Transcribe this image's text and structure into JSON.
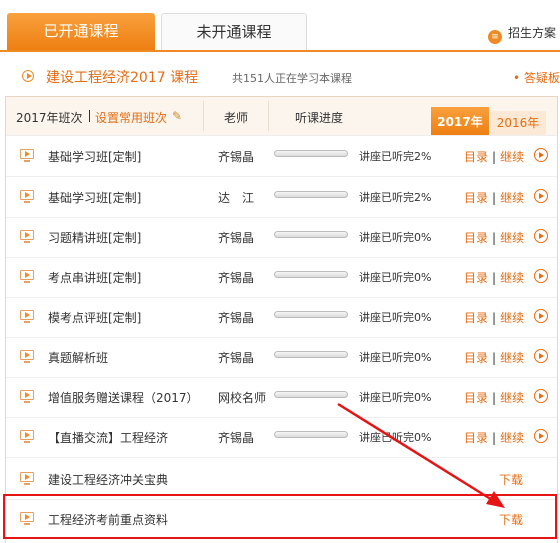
{
  "tabs": {
    "active": "已开通课程",
    "inactive": "未开通课程"
  },
  "admission": {
    "icon": "list-icon",
    "label": "招生方案"
  },
  "course": {
    "title": "建设工程经济2017 课程",
    "count_text": "共151人正在学习本课程",
    "qa_link": "• 答疑板"
  },
  "table_header": {
    "class_label": "2017年班次",
    "setting_label": "设置常用班次",
    "teacher_label": "老师",
    "progress_label": "听课进度",
    "year_active": "2017年",
    "year_inactive": "2016年"
  },
  "rows": [
    {
      "name": "基础学习班[定制]",
      "teacher": "齐锡晶",
      "progress": "讲座已听完2%",
      "catalog": "目录",
      "sep": "|",
      "continue": "继续"
    },
    {
      "name": "基础学习班[定制]",
      "teacher": "达　江",
      "progress": "讲座已听完2%",
      "catalog": "目录",
      "sep": "|",
      "continue": "继续"
    },
    {
      "name": "习题精讲班[定制]",
      "teacher": "齐锡晶",
      "progress": "讲座已听完0%",
      "catalog": "目录",
      "sep": "|",
      "continue": "继续"
    },
    {
      "name": "考点串讲班[定制]",
      "teacher": "齐锡晶",
      "progress": "讲座已听完0%",
      "catalog": "目录",
      "sep": "|",
      "continue": "继续"
    },
    {
      "name": "模考点评班[定制]",
      "teacher": "齐锡晶",
      "progress": "讲座已听完0%",
      "catalog": "目录",
      "sep": "|",
      "continue": "继续"
    },
    {
      "name": "真题解析班",
      "teacher": "齐锡晶",
      "progress": "讲座已听完0%",
      "catalog": "目录",
      "sep": "|",
      "continue": "继续"
    },
    {
      "name": "增值服务赠送课程（2017）",
      "teacher": "网校名师",
      "progress": "讲座已听完0%",
      "catalog": "目录",
      "sep": "|",
      "continue": "继续"
    },
    {
      "name": "【直播交流】工程经济",
      "teacher": "齐锡晶",
      "progress": "讲座已听完0%",
      "catalog": "目录",
      "sep": "|",
      "continue": "继续"
    }
  ],
  "downloads": [
    {
      "name": "建设工程经济冲关宝典",
      "action": "下载"
    },
    {
      "name": "工程经济考前重点资料",
      "action": "下载"
    }
  ],
  "colors": {
    "accent": "#f08a24",
    "link": "#e66c12",
    "highlight": "#e61414"
  }
}
